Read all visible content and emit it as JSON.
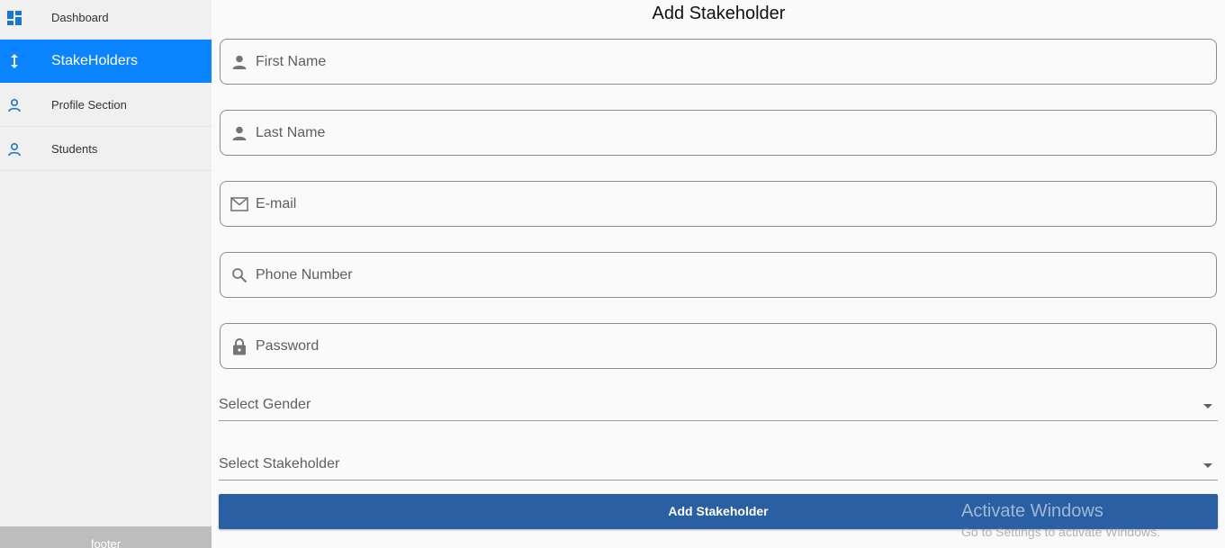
{
  "sidebar": {
    "items": [
      {
        "label": "Dashboard",
        "icon": "dashboard-icon"
      },
      {
        "label": "StakeHolders",
        "icon": "vertical-arrows-icon",
        "active": true
      },
      {
        "label": "Profile Section",
        "icon": "person-outline-icon"
      },
      {
        "label": "Students",
        "icon": "person-outline-icon"
      }
    ],
    "footer": "footer"
  },
  "form": {
    "title": "Add Stakeholder",
    "fields": [
      {
        "placeholder": "First Name",
        "icon": "person-icon"
      },
      {
        "placeholder": "Last Name",
        "icon": "person-icon"
      },
      {
        "placeholder": "E-mail",
        "icon": "mail-icon"
      },
      {
        "placeholder": "Phone Number",
        "icon": "search-icon"
      },
      {
        "placeholder": "Password",
        "icon": "lock-icon"
      }
    ],
    "selects": [
      {
        "label": "Select Gender"
      },
      {
        "label": "Select Stakeholder"
      }
    ],
    "submit_label": "Add Stakeholder"
  },
  "watermark": {
    "line1": "Activate Windows",
    "line2": "Go to Settings to activate Windows."
  },
  "colors": {
    "accent": "#0a84ff",
    "button": "#2a5fa3",
    "sidebar_bg": "#f0f0f0"
  }
}
